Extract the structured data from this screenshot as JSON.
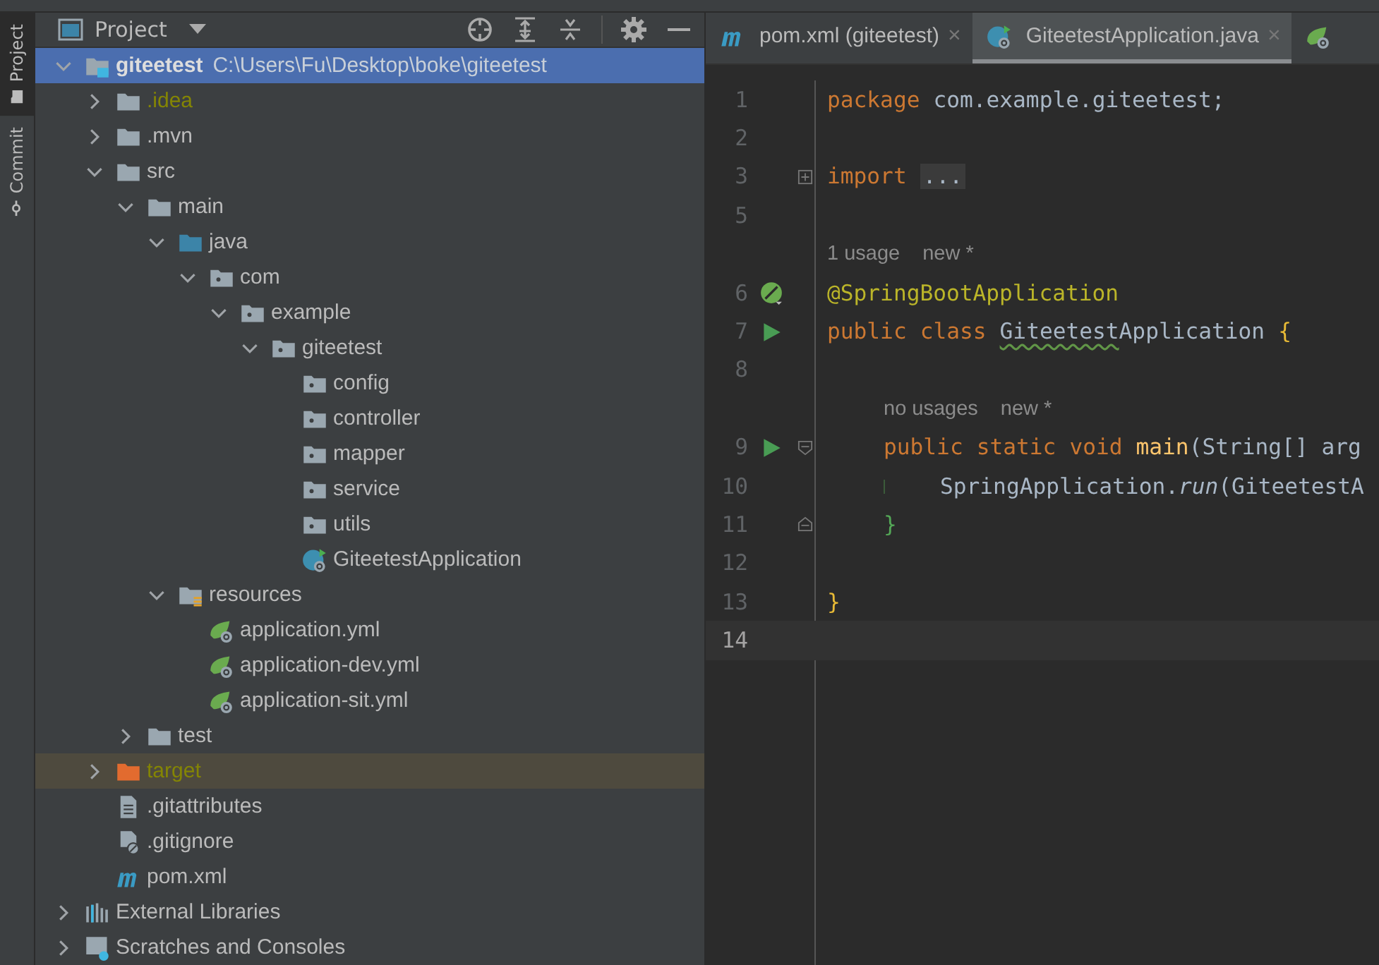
{
  "tool_strip": {
    "tabs": [
      {
        "label": "Project",
        "selected": true
      },
      {
        "label": "Commit",
        "selected": false
      }
    ]
  },
  "project_panel": {
    "title": "Project",
    "tree": [
      {
        "label": "giteetest",
        "path": "C:\\Users\\Fu\\Desktop\\boke\\giteetest",
        "kind": "module",
        "selected": true,
        "ignored": false,
        "expanded": true,
        "children": [
          {
            "label": ".idea",
            "kind": "folder",
            "selected": false,
            "ignored": true,
            "expanded": false
          },
          {
            "label": ".mvn",
            "kind": "folder",
            "selected": false,
            "ignored": false,
            "expanded": false
          },
          {
            "label": "src",
            "kind": "folder",
            "selected": false,
            "ignored": false,
            "expanded": true,
            "children": [
              {
                "label": "main",
                "kind": "folder",
                "selected": false,
                "ignored": false,
                "expanded": true,
                "children": [
                  {
                    "label": "java",
                    "kind": "source-folder",
                    "selected": false,
                    "ignored": false,
                    "expanded": true,
                    "children": [
                      {
                        "label": "com",
                        "kind": "package",
                        "selected": false,
                        "ignored": false,
                        "expanded": true,
                        "children": [
                          {
                            "label": "example",
                            "kind": "package",
                            "selected": false,
                            "ignored": false,
                            "expanded": true,
                            "children": [
                              {
                                "label": "giteetest",
                                "kind": "package",
                                "selected": false,
                                "ignored": false,
                                "expanded": true,
                                "children": [
                                  {
                                    "label": "config",
                                    "kind": "package",
                                    "selected": false,
                                    "ignored": false
                                  },
                                  {
                                    "label": "controller",
                                    "kind": "package",
                                    "selected": false,
                                    "ignored": false
                                  },
                                  {
                                    "label": "mapper",
                                    "kind": "package",
                                    "selected": false,
                                    "ignored": false
                                  },
                                  {
                                    "label": "service",
                                    "kind": "package",
                                    "selected": false,
                                    "ignored": false
                                  },
                                  {
                                    "label": "utils",
                                    "kind": "package",
                                    "selected": false,
                                    "ignored": false
                                  },
                                  {
                                    "label": "GiteetestApplication",
                                    "kind": "spring-class",
                                    "selected": false,
                                    "ignored": false
                                  }
                                ]
                              }
                            ]
                          }
                        ]
                      }
                    ]
                  },
                  {
                    "label": "resources",
                    "kind": "resources-folder",
                    "selected": false,
                    "ignored": false,
                    "expanded": true,
                    "children": [
                      {
                        "label": "application.yml",
                        "kind": "spring-config",
                        "selected": false,
                        "ignored": false
                      },
                      {
                        "label": "application-dev.yml",
                        "kind": "spring-config",
                        "selected": false,
                        "ignored": false
                      },
                      {
                        "label": "application-sit.yml",
                        "kind": "spring-config",
                        "selected": false,
                        "ignored": false
                      }
                    ]
                  }
                ]
              },
              {
                "label": "test",
                "kind": "folder",
                "selected": false,
                "ignored": false,
                "expanded": false
              }
            ]
          },
          {
            "label": "target",
            "kind": "excluded-folder",
            "selected": false,
            "ignored": true,
            "expanded": false
          },
          {
            "label": ".gitattributes",
            "kind": "text-file",
            "selected": false,
            "ignored": false
          },
          {
            "label": ".gitignore",
            "kind": "ignore-file",
            "selected": false,
            "ignored": false
          },
          {
            "label": "pom.xml",
            "kind": "maven",
            "selected": false,
            "ignored": false
          }
        ]
      },
      {
        "label": "External Libraries",
        "kind": "libraries",
        "selected": false,
        "ignored": false,
        "expanded": false
      },
      {
        "label": "Scratches and Consoles",
        "kind": "scratches",
        "selected": false,
        "ignored": false,
        "expanded": false
      }
    ]
  },
  "editor": {
    "tabs": [
      {
        "label": "pom.xml (giteetest)",
        "kind": "maven",
        "close": "×",
        "selected": false
      },
      {
        "label": "GiteetestApplication.java",
        "kind": "spring-class",
        "close": "×",
        "selected": true
      },
      {
        "kind": "spring-config",
        "selected": false
      }
    ],
    "lines": [
      {
        "kind": "code",
        "number": "1",
        "current": false,
        "words": [
          {
            "parts": [
              {
                "text": "package",
                "kind": "keyword"
              }
            ]
          },
          {
            "parts": [
              {
                "text": "com.example.giteetest;",
                "kind": "plain"
              }
            ]
          }
        ]
      },
      {
        "kind": "code",
        "number": "2",
        "current": false
      },
      {
        "kind": "code",
        "number": "3",
        "current": false,
        "fold": {
          "kind": "collapsed"
        },
        "words": [
          {
            "parts": [
              {
                "text": "import",
                "kind": "keyword"
              }
            ]
          },
          {
            "parts": [
              {
                "text": "...",
                "kind": "folded"
              }
            ]
          }
        ]
      },
      {
        "kind": "code",
        "number": "5",
        "current": false
      },
      {
        "kind": "hint",
        "indented": false,
        "hints": [
          "1 usage",
          "new *"
        ]
      },
      {
        "kind": "code",
        "number": "6",
        "current": false,
        "marker": {
          "kind": "spring"
        },
        "words": [
          {
            "parts": [
              {
                "text": "@SpringBootApplication",
                "kind": "annotation"
              }
            ]
          }
        ]
      },
      {
        "kind": "code",
        "number": "7",
        "current": false,
        "marker": {
          "kind": "run"
        },
        "words": [
          {
            "parts": [
              {
                "text": "public",
                "kind": "keyword"
              }
            ]
          },
          {
            "parts": [
              {
                "text": "class",
                "kind": "keyword"
              }
            ]
          },
          {
            "parts": [
              {
                "text": "Giteetest",
                "kind": "typo"
              },
              {
                "text": "Application",
                "kind": "plain"
              }
            ]
          },
          {
            "parts": [
              {
                "text": "{",
                "kind": "brace"
              }
            ]
          }
        ]
      },
      {
        "kind": "code",
        "number": "8",
        "current": false
      },
      {
        "kind": "hint",
        "indented": true,
        "hints": [
          "no usages",
          "new *"
        ]
      },
      {
        "kind": "code",
        "number": "9",
        "current": false,
        "marker": {
          "kind": "run"
        },
        "fold": {
          "kind": "start"
        },
        "indented": true,
        "words": [
          {
            "parts": [
              {
                "text": "public",
                "kind": "keyword"
              }
            ]
          },
          {
            "parts": [
              {
                "text": "static",
                "kind": "keyword"
              }
            ]
          },
          {
            "parts": [
              {
                "text": "void",
                "kind": "keyword"
              }
            ]
          },
          {
            "parts": [
              {
                "text": "main",
                "kind": "method"
              },
              {
                "text": "(String[] arg",
                "kind": "plain"
              }
            ]
          }
        ]
      },
      {
        "kind": "code",
        "number": "10",
        "current": false,
        "fold": {
          "kind": "guide"
        },
        "indented": true,
        "words": [
          {
            "parts": [
              {
                "text": "SpringApplication.",
                "kind": "plain"
              },
              {
                "text": "run",
                "kind": "italic"
              },
              {
                "text": "(GiteetestA",
                "kind": "plain"
              }
            ]
          }
        ]
      },
      {
        "kind": "code",
        "number": "11",
        "current": false,
        "fold": {
          "kind": "end"
        },
        "indented": true,
        "words": [
          {
            "parts": [
              {
                "text": "}",
                "kind": "brace2"
              }
            ]
          }
        ]
      },
      {
        "kind": "code",
        "number": "12",
        "current": false
      },
      {
        "kind": "code",
        "number": "13",
        "current": false,
        "words": [
          {
            "parts": [
              {
                "text": "}",
                "kind": "brace"
              }
            ]
          }
        ]
      },
      {
        "kind": "code",
        "number": "14",
        "current": true
      }
    ]
  }
}
